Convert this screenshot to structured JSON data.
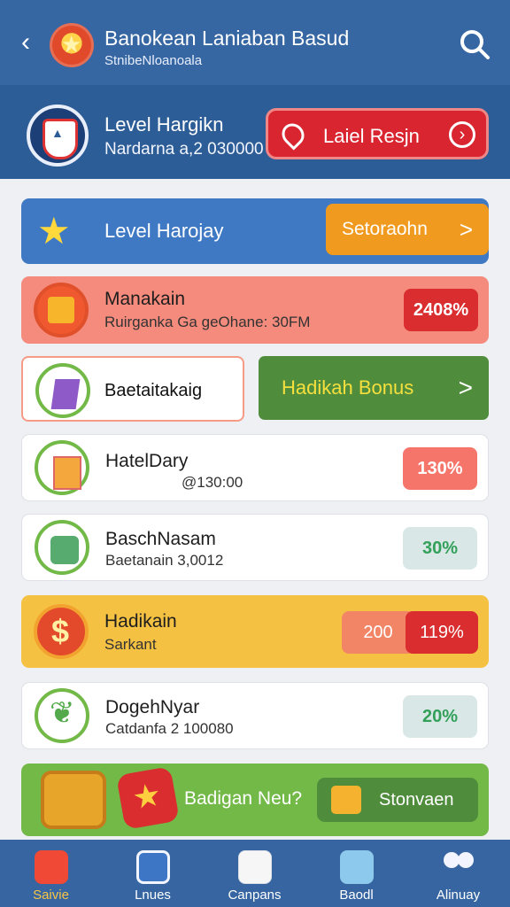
{
  "header": {
    "title": "Banokean Laniaban Basud",
    "subtitle": "StnibeNloanoala",
    "back_icon": "chevron-left-icon",
    "search_icon": "search-icon",
    "logo_icon": "trophy-icon"
  },
  "hero": {
    "level_title": "Level Hargikn",
    "level_value": "Nardarna a,2 030000",
    "button_label": "Laiel Resjn",
    "button_icon": "location-pin-icon",
    "arrow_icon": "arrow-right-icon"
  },
  "level_row": {
    "title": "Level Harojay",
    "button_label": "Setoraohn",
    "button_chevron": ">"
  },
  "rows": [
    {
      "title": "Manakain",
      "subtitle": "Ruirganka Ga geOhane: 30FM",
      "value": "2408%"
    },
    {
      "title": "Baetaitakaig",
      "value": "Hadikah Bonus",
      "chevron": ">"
    },
    {
      "title": "HatelDary",
      "subtitle": "@130:00",
      "value": "130%"
    },
    {
      "title": "BaschNasam",
      "subtitle": "Baetanain 3,0012",
      "value": "30%"
    },
    {
      "title": "Hadikain",
      "subtitle": "Sarkant",
      "value_left": "200",
      "value_right": "119%"
    },
    {
      "title": "DogehNyar",
      "subtitle": "Catdanfa 2 100080",
      "value": "20%"
    }
  ],
  "promo": {
    "text": "Badigan Neu?",
    "button_label": "Stonvaen"
  },
  "nav": {
    "items": [
      {
        "label": "Saivie",
        "icon": "alarm-icon"
      },
      {
        "label": "Lnues",
        "icon": "stats-icon"
      },
      {
        "label": "Canpans",
        "icon": "profile-icon"
      },
      {
        "label": "Baodl",
        "icon": "clipboard-icon"
      },
      {
        "label": "Alinuay",
        "icon": "users-icon"
      }
    ]
  },
  "colors": {
    "header": "#3767a3",
    "hero": "#2d5d96",
    "red": "#d9252f",
    "green": "#72b948",
    "gold": "#f4c142",
    "blue_button": "#3f79c4"
  }
}
